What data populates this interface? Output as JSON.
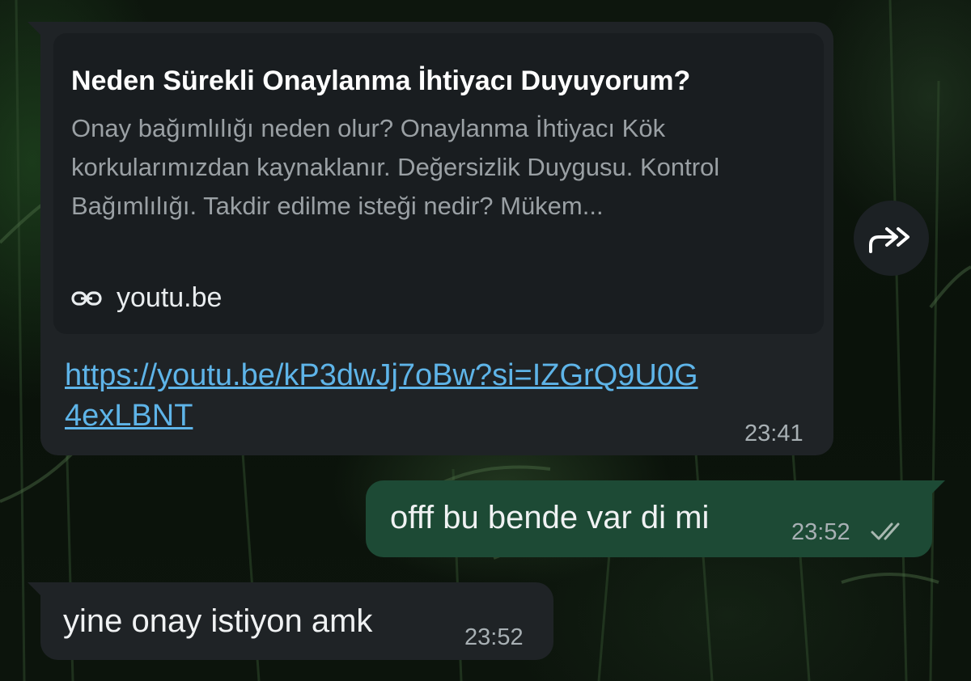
{
  "messages": {
    "link_message": {
      "preview_title": "Neden Sürekli Onaylanma İhtiyacı Duyuyorum?",
      "preview_description": "Onay bağımlılığı neden olur? Onaylanma İhtiyacı Kök korkularımızdan kaynaklanır. Değersizlik Duygusu. Kontrol Bağımlılığı.  Takdir edilme isteği nedir? Mükem...",
      "preview_source": "youtu.be",
      "url": "https://youtu.be/kP3dwJj7oBw?si=IZGrQ9U0G4exLBNT",
      "time": "23:41"
    },
    "outgoing_message": {
      "text": "offf bu bende var di mi",
      "time": "23:52",
      "status_icon": "double-check-icon"
    },
    "incoming_message": {
      "text": "yine onay istiyon amk",
      "time": "23:52"
    }
  },
  "icons": {
    "link": "link-icon",
    "forward": "forward-icon"
  },
  "colors": {
    "incoming_bubble": "#1f2326",
    "outgoing_bubble": "#1d4a35",
    "link": "#5eb4e8",
    "preview_background": "#191d20"
  }
}
